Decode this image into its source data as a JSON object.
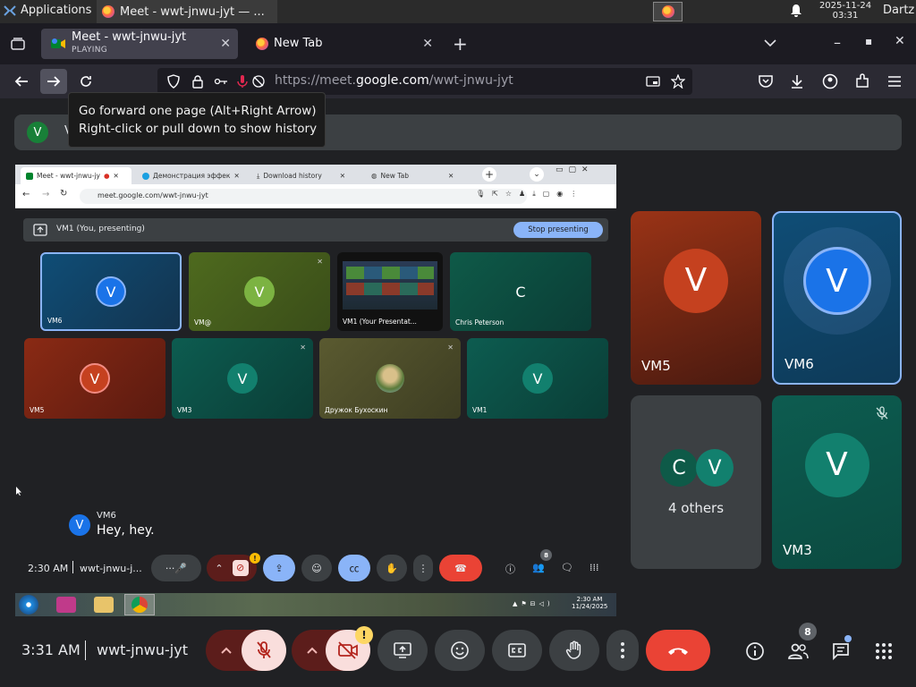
{
  "os": {
    "apps_label": "Applications",
    "task_title": "Meet - wwt-jnwu-jyt — ...",
    "clock_date": "2025-11-24",
    "clock_time": "03:31",
    "user": "Dartz"
  },
  "browser": {
    "tabs": [
      {
        "title": "Meet - wwt-jnwu-jyt",
        "subtitle": "PLAYING"
      },
      {
        "title": "New Tab"
      }
    ],
    "url_prefix": "https://meet.",
    "url_domain": "google.com",
    "url_path": "/wwt-jnwu-jyt",
    "tooltip_line1": "Go forward one page (Alt+Right Arrow)",
    "tooltip_line2": "Right-click or pull down to show history"
  },
  "meet": {
    "banner_avatar": "V",
    "banner_letter": "V",
    "shared": {
      "tabs": [
        "Meet - wwt-jnwu-jy",
        "Демонстрация эффек",
        "Download history",
        "New Tab"
      ],
      "url": "meet.google.com/wwt-jnwu-jyt",
      "present_label": "VM1 (You, presenting)",
      "stop_label": "Stop presenting",
      "tiles": [
        {
          "name": "VM6",
          "letter": "V"
        },
        {
          "name": "VM@",
          "letter": "V"
        },
        {
          "name": "VM1 (Your Presentat...",
          "letter": ""
        },
        {
          "name": "Chris Peterson",
          "letter": "C"
        },
        {
          "name": "VM5",
          "letter": "V"
        },
        {
          "name": "VM3",
          "letter": "V"
        },
        {
          "name": "Дружок Бухоскин",
          "letter": ""
        },
        {
          "name": "VM1",
          "letter": "V"
        }
      ],
      "caption_avatar": "V",
      "caption_name": "VM6",
      "caption_text": "Hey, hey.",
      "bar_time": "2:30 AM",
      "bar_code": "wwt-jnwu-j...",
      "bar_people_count": "8",
      "taskbar_time": "2:30 AM",
      "taskbar_date": "11/24/2025"
    },
    "tiles": [
      {
        "name": "VM5",
        "letter": "V"
      },
      {
        "name": "VM6",
        "letter": "V"
      },
      {
        "name": "4 others",
        "letters": [
          "C",
          "V"
        ]
      },
      {
        "name": "VM3",
        "letter": "V"
      }
    ],
    "controls": {
      "time": "3:31 AM",
      "code": "wwt-jnwu-jyt",
      "people_count": "8",
      "camera_alert": "!"
    }
  },
  "colors": {
    "meet_bg": "#202124",
    "red_button": "#ea4335",
    "accent_blue": "#8ab4f8",
    "vm5_tile": "#8a2a14",
    "vm6_tile": "#0e4a6e",
    "vm3_tile": "#0d5c50"
  }
}
